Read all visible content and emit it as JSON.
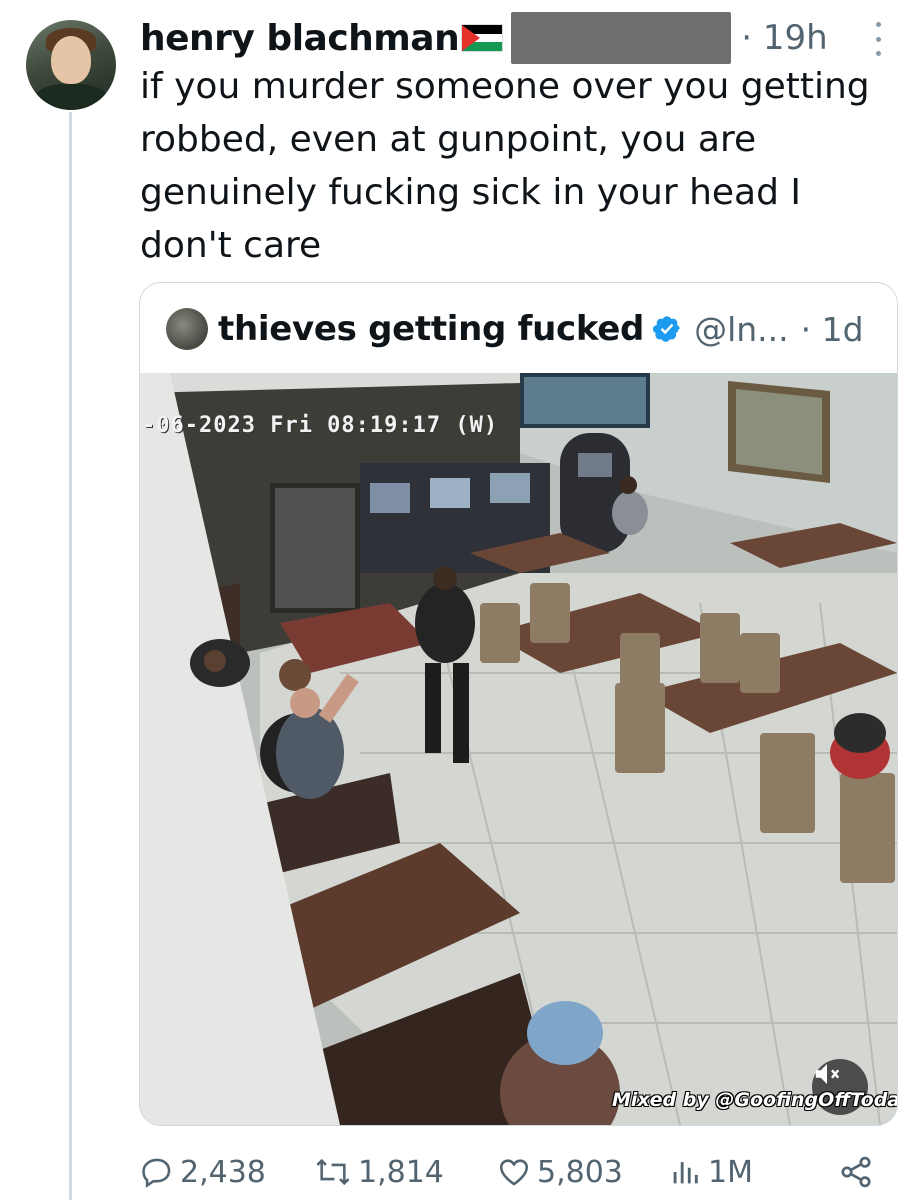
{
  "tweet": {
    "author_name": "henry blachman",
    "author_flag_emoji": "palestine-flag",
    "time": "· 19h",
    "text": "if you murder someone over you getting robbed, even at gunpoint, you are genuinely fucking sick in your head I don't care"
  },
  "quote": {
    "author_name": "thieves getting fucked",
    "handle": "@ln...",
    "time": "· 1d",
    "verified": true,
    "video": {
      "cctv_timestamp": "-06-2023 Fri 08:19:17 (W)",
      "watermark": "Mixed by @GoofingOffToday",
      "muted": true
    }
  },
  "actions": {
    "replies": "2,438",
    "reposts": "1,814",
    "likes": "5,803",
    "views": "1M"
  },
  "colors": {
    "text_primary": "#0f1419",
    "text_secondary": "#536471",
    "verified_blue": "#1d9bf0",
    "border": "#cfd9de"
  },
  "icons": [
    "more-icon",
    "verified-badge-icon",
    "mute-icon",
    "reply-icon",
    "repost-icon",
    "like-icon",
    "views-icon",
    "share-icon"
  ]
}
